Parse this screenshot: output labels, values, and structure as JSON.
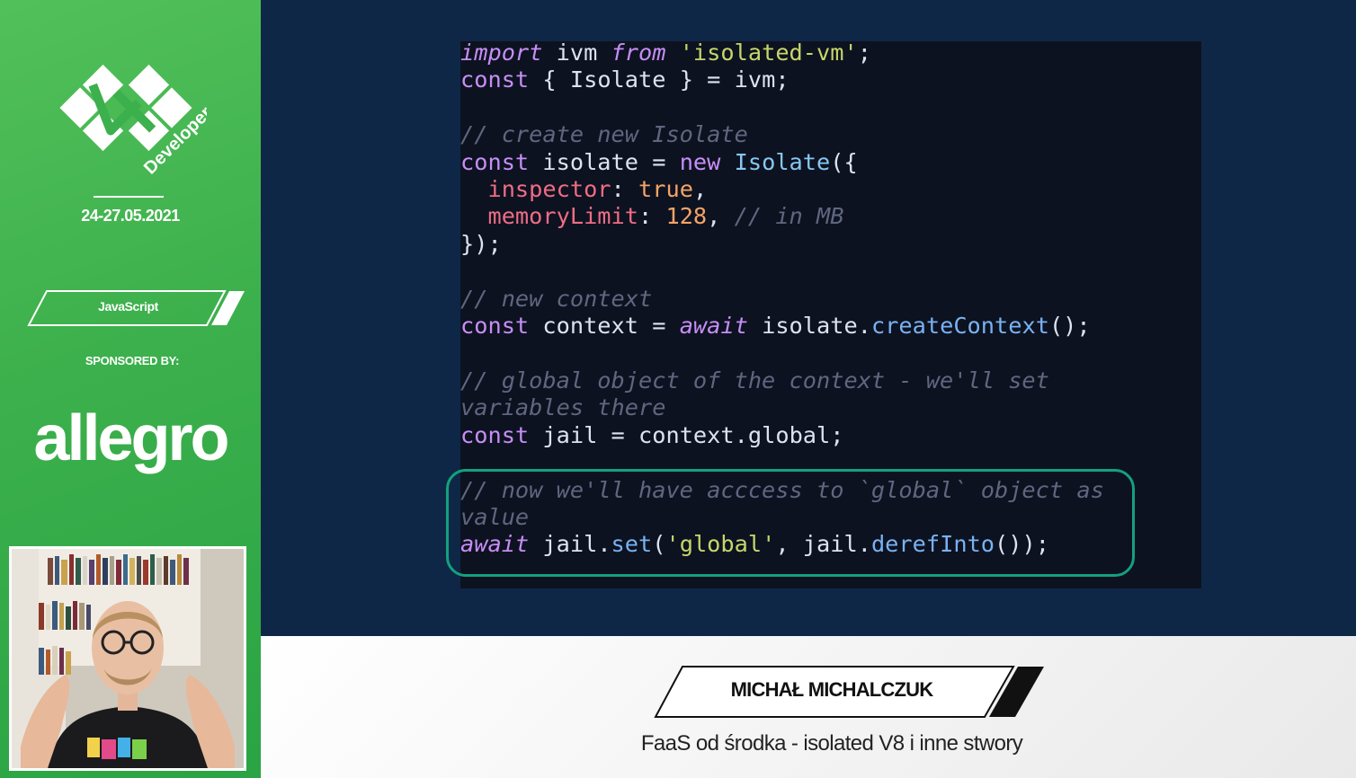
{
  "sidebar": {
    "logo_text": "Developers",
    "date": "24-27.05.2021",
    "topic": "JavaScript",
    "sponsored_label": "SPONSORED BY:",
    "sponsor_name": "allegro",
    "brand_color": "#3cb04c"
  },
  "code": {
    "lines": [
      [
        [
          "kwi",
          "import"
        ],
        [
          "id",
          " ivm "
        ],
        [
          "kwi",
          "from"
        ],
        [
          "id",
          " "
        ],
        [
          "str",
          "'isolated-vm'"
        ],
        [
          "pun",
          ";"
        ]
      ],
      [
        [
          "kw",
          "const"
        ],
        [
          "pun",
          " { "
        ],
        [
          "id",
          "Isolate"
        ],
        [
          "pun",
          " } = "
        ],
        [
          "id",
          "ivm"
        ],
        [
          "pun",
          ";"
        ]
      ],
      [],
      [
        [
          "cm",
          "// create new Isolate"
        ]
      ],
      [
        [
          "kw",
          "const"
        ],
        [
          "id",
          " isolate "
        ],
        [
          "pun",
          "= "
        ],
        [
          "kw",
          "new"
        ],
        [
          "id",
          " "
        ],
        [
          "cls",
          "Isolate"
        ],
        [
          "pun",
          "({"
        ]
      ],
      [
        [
          "id",
          "  "
        ],
        [
          "prop",
          "inspector"
        ],
        [
          "pun",
          ": "
        ],
        [
          "num",
          "true"
        ],
        [
          "pun",
          ","
        ]
      ],
      [
        [
          "id",
          "  "
        ],
        [
          "prop",
          "memoryLimit"
        ],
        [
          "pun",
          ": "
        ],
        [
          "num",
          "128"
        ],
        [
          "pun",
          ", "
        ],
        [
          "cm",
          "// in MB"
        ]
      ],
      [
        [
          "pun",
          "});"
        ]
      ],
      [],
      [
        [
          "cm",
          "// new context"
        ]
      ],
      [
        [
          "kw",
          "const"
        ],
        [
          "id",
          " context "
        ],
        [
          "pun",
          "= "
        ],
        [
          "kwi",
          "await"
        ],
        [
          "id",
          " isolate"
        ],
        [
          "pun",
          "."
        ],
        [
          "fn",
          "createContext"
        ],
        [
          "pun",
          "();"
        ]
      ],
      [],
      [
        [
          "cm",
          "// global object of the context - we'll set"
        ]
      ],
      [
        [
          "cm",
          "variables there"
        ]
      ],
      [
        [
          "kw",
          "const"
        ],
        [
          "id",
          " jail "
        ],
        [
          "pun",
          "= "
        ],
        [
          "id",
          "context"
        ],
        [
          "pun",
          "."
        ],
        [
          "id",
          "global"
        ],
        [
          "pun",
          ";"
        ]
      ],
      [],
      [
        [
          "cm",
          "// now we'll have acccess to `global` object as"
        ]
      ],
      [
        [
          "cm",
          "value"
        ]
      ],
      [
        [
          "kwi",
          "await"
        ],
        [
          "id",
          " jail"
        ],
        [
          "pun",
          "."
        ],
        [
          "fn",
          "set"
        ],
        [
          "pun",
          "("
        ],
        [
          "str",
          "'global'"
        ],
        [
          "pun",
          ", "
        ],
        [
          "id",
          "jail"
        ],
        [
          "pun",
          "."
        ],
        [
          "fn",
          "derefInto"
        ],
        [
          "pun",
          "());"
        ]
      ]
    ]
  },
  "lower_third": {
    "speaker_name": "MICHAŁ MICHALCZUK",
    "talk_title": "FaaS od środka - isolated V8 i inne stwory"
  },
  "colors": {
    "slide_bg": "#0f2746",
    "code_bg": "#0d1220",
    "highlight": "#13a17e"
  }
}
